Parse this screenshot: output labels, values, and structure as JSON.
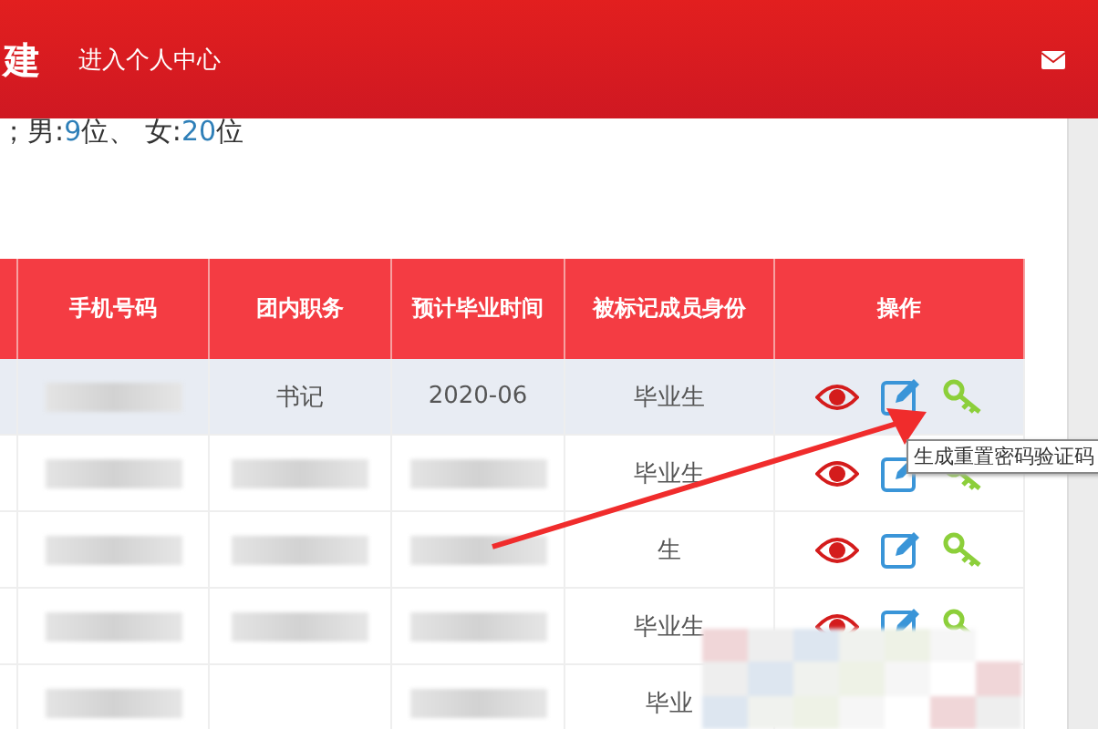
{
  "header": {
    "title": "建",
    "link": "进入个人中心"
  },
  "summary": [
    {
      "text": "；男:",
      "kind": "plain"
    },
    {
      "text": "9",
      "kind": "number"
    },
    {
      "text": "位、 女:",
      "kind": "plain"
    },
    {
      "text": "20",
      "kind": "number"
    },
    {
      "text": "位",
      "kind": "plain"
    }
  ],
  "table": {
    "columns": [
      "手机号码",
      "团内职务",
      "预计毕业时间",
      "被标记成员身份",
      "操作"
    ],
    "rows": [
      {
        "selected": true,
        "cells": [
          {
            "kind": "redacted"
          },
          {
            "kind": "text",
            "text": "书记"
          },
          {
            "kind": "text",
            "text": "2020-06"
          },
          {
            "kind": "text",
            "text": "毕业生"
          },
          {
            "kind": "actions"
          }
        ]
      },
      {
        "selected": false,
        "cells": [
          {
            "kind": "redacted"
          },
          {
            "kind": "redacted"
          },
          {
            "kind": "redacted"
          },
          {
            "kind": "text",
            "text": "毕业生"
          },
          {
            "kind": "actions"
          }
        ]
      },
      {
        "selected": false,
        "cells": [
          {
            "kind": "redacted"
          },
          {
            "kind": "redacted"
          },
          {
            "kind": "redacted"
          },
          {
            "kind": "text",
            "text": "生"
          },
          {
            "kind": "actions"
          }
        ]
      },
      {
        "selected": false,
        "cells": [
          {
            "kind": "redacted"
          },
          {
            "kind": "redacted"
          },
          {
            "kind": "redacted"
          },
          {
            "kind": "text",
            "text": "毕业生"
          },
          {
            "kind": "actions"
          }
        ]
      },
      {
        "selected": false,
        "cells": [
          {
            "kind": "redacted"
          },
          {
            "kind": "empty"
          },
          {
            "kind": "redacted"
          },
          {
            "kind": "text",
            "text": "毕业"
          },
          {
            "kind": "covered"
          }
        ]
      }
    ]
  },
  "tooltip": {
    "text": "生成重置密码验证码"
  }
}
